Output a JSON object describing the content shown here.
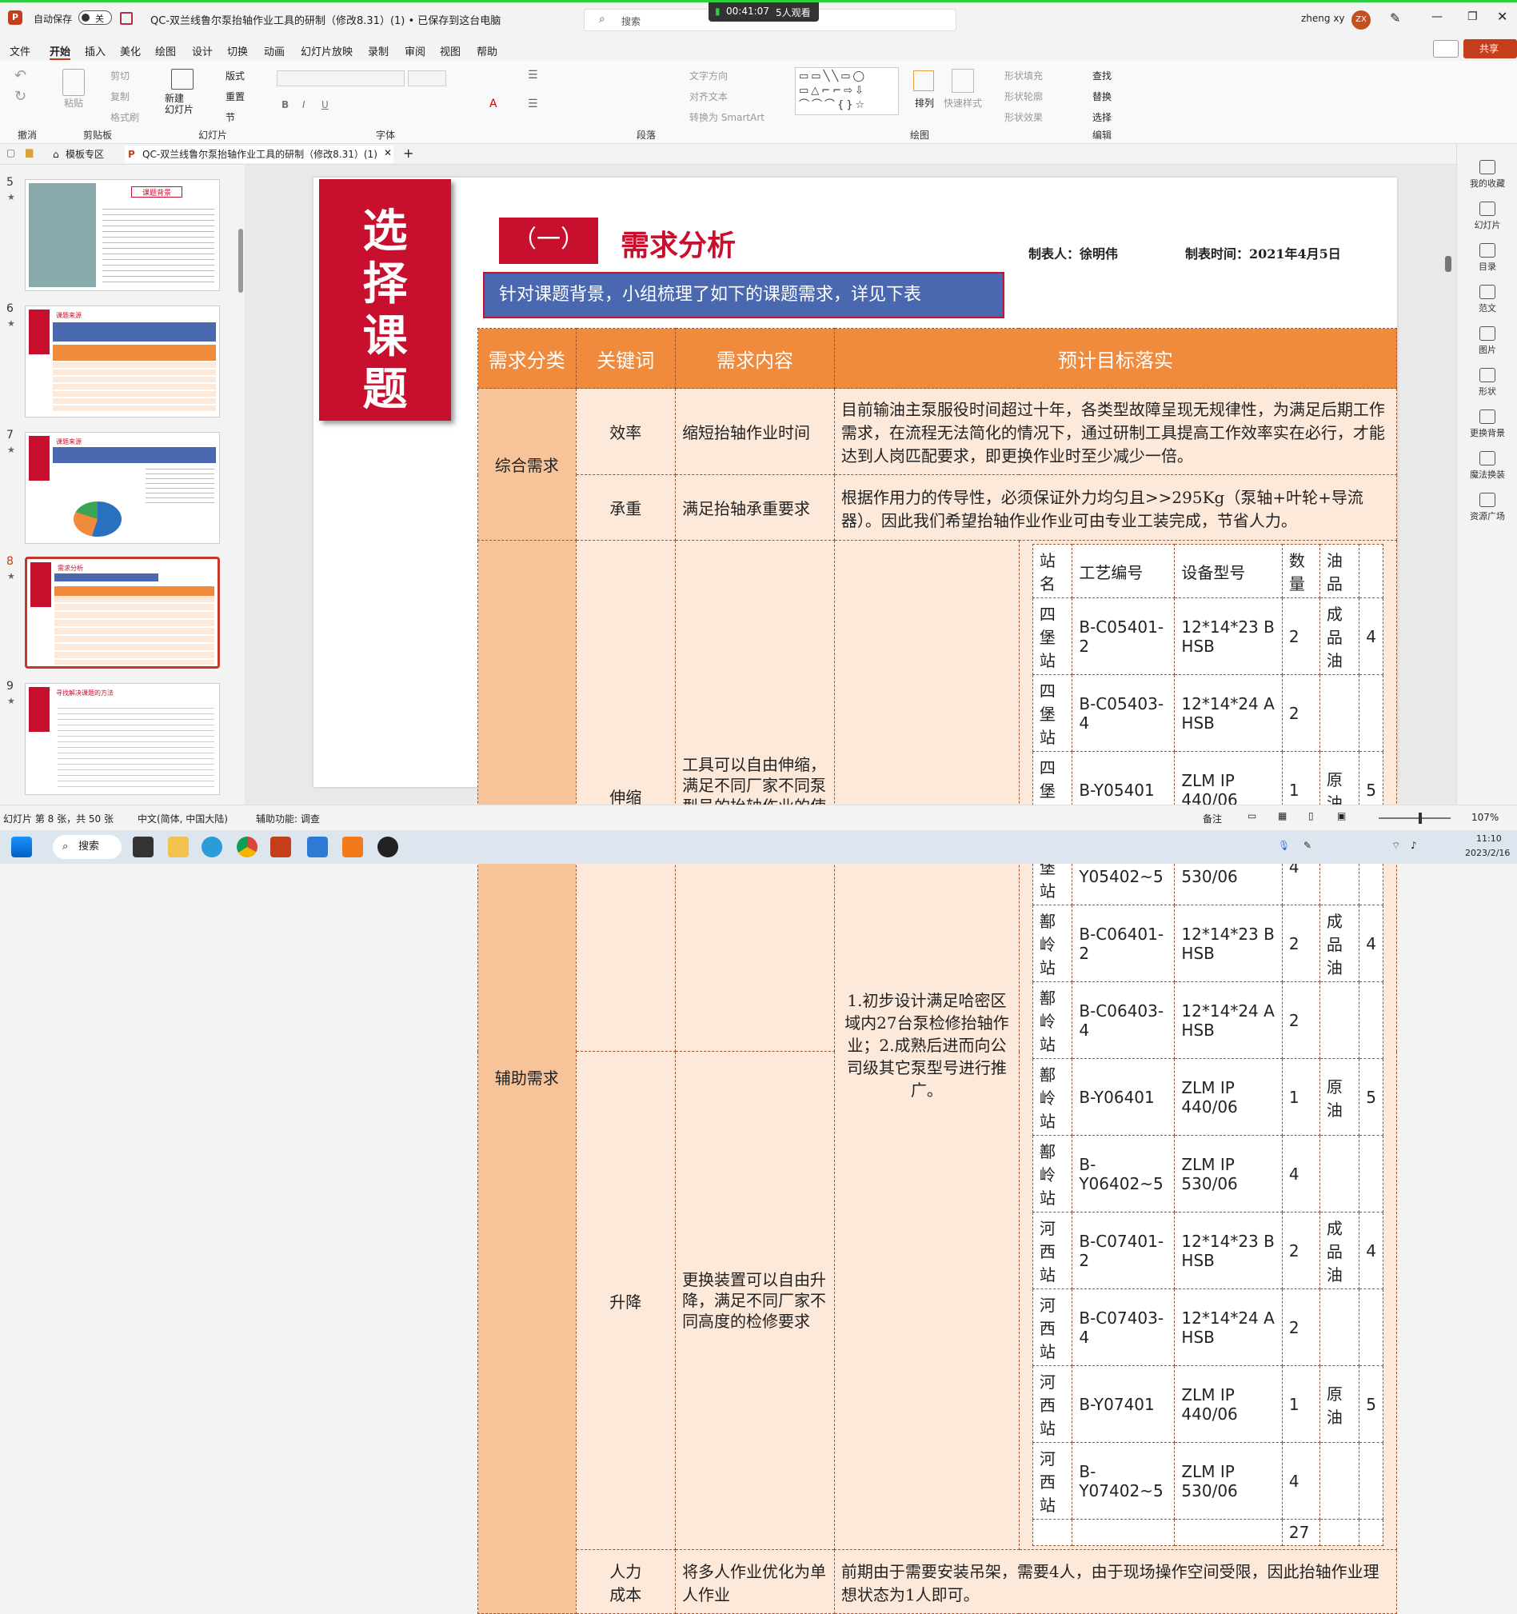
{
  "titlebar": {
    "autosave_label": "自动保存",
    "autosave_state": "关",
    "doc_title": "QC-双兰线鲁尔泵抬轴作业工具的研制（修改8.31）(1) • 已保存到这台电脑",
    "search_placeholder": "搜索",
    "live_time": "00:41:07",
    "live_viewers": "5人观看",
    "user_name": "zheng xy",
    "user_initials": "ZX"
  },
  "menu": [
    "文件",
    "开始",
    "插入",
    "美化",
    "绘图",
    "设计",
    "切换",
    "动画",
    "幻灯片放映",
    "录制",
    "审阅",
    "视图",
    "帮助"
  ],
  "share_label": "共享",
  "ribbon": {
    "undo_group": "撤消",
    "clipboard": {
      "paste": "粘贴",
      "cut": "剪切",
      "copy": "复制",
      "format": "格式刷",
      "label": "剪贴板"
    },
    "slides": {
      "new": "新建\n幻灯片",
      "layout": "版式",
      "reset": "重置",
      "section": "节",
      "label": "幻灯片"
    },
    "font_label": "字体",
    "paragraph": {
      "text_dir": "文字方向",
      "align_text": "对齐文本",
      "smartart": "转换为 SmartArt",
      "label": "段落"
    },
    "drawing": {
      "arrange": "排列",
      "quick_styles": "快速样式",
      "fill": "形状填充",
      "outline": "形状轮廓",
      "effects": "形状效果",
      "label": "绘图"
    },
    "editing": {
      "find": "查找",
      "replace": "替换",
      "select": "选择",
      "label": "编辑"
    }
  },
  "tabs": {
    "template": "模板专区",
    "file_tab": "QC-双兰线鲁尔泵抬轴作业工具的研制（修改8.31）(1)"
  },
  "thumbnails": [
    {
      "num": "5",
      "title": "课题背景"
    },
    {
      "num": "6",
      "title": "课题来源"
    },
    {
      "num": "7",
      "title": "课题来源"
    },
    {
      "num": "8",
      "title": "需求分析"
    },
    {
      "num": "9",
      "title": "寻找解决课题的方法"
    }
  ],
  "slide": {
    "vertical_title": [
      "选",
      "择",
      "课",
      "题"
    ],
    "section_no": "（一）",
    "section_title": "需求分析",
    "maker": "制表人：徐明伟",
    "date": "制表时间：2021年4月5日",
    "banner": "针对课题背景，小组梳理了如下的课题需求，详见下表",
    "headers": [
      "需求分类",
      "关键词",
      "需求内容",
      "预计目标落实"
    ],
    "cat1": "综合需求",
    "cat2": "辅助需求",
    "rows": [
      {
        "kw": "效率",
        "content": "缩短抬轴作业时间",
        "target": "目前输油主泵服役时间超过十年，各类型故障呈现无规律性，为满足后期工作需求，在流程无法简化的情况下，通过研制工具提高工作效率实在必行，才能达到人岗匹配要求，即更换作业时至少减少一倍。"
      },
      {
        "kw": "承重",
        "content": "满足抬轴承重要求",
        "target": "根据作用力的传导性，必须保证外力均匀且>>295Kg（泵轴+叶轮+导流器）。因此我们希望抬轴作业作业可由专业工装完成，节省人力。"
      },
      {
        "kw": "伸缩",
        "content": "工具可以自由伸缩，满足不同厂家不同泵型号的抬轴作业的使用"
      },
      {
        "kw": "升降",
        "content": "更换装置可以自由升降，满足不同厂家不同高度的检修要求"
      },
      {
        "kw": "人力\n成本",
        "content": "将多人作业优化为单人作业",
        "target": "前期由于需要安装吊架，需要4人，由于现场操作空间受限，因此抬轴作业理想状态为1人即可。"
      }
    ],
    "shared_target": "1.初步设计满足哈密区域内27台泵检修抬轴作业；2.成熟后进而向公司级其它泵型号进行推广。",
    "mini_headers": [
      "站名",
      "工艺编号",
      "设备型号",
      "数量",
      "油品",
      ""
    ],
    "mini_rows": [
      [
        "四堡站",
        "B-C05401-2",
        "12*14*23 B HSB",
        "2",
        "成品油",
        "4"
      ],
      [
        "四堡站",
        "B-C05403-4",
        "12*14*24 A HSB",
        "2",
        "",
        ""
      ],
      [
        "四堡站",
        "B-Y05401",
        "ZLM IP 440/06",
        "1",
        "原油",
        "5"
      ],
      [
        "四堡站",
        "B-Y05402~5",
        "ZLM IP 530/06",
        "4",
        "",
        ""
      ],
      [
        "鄯岭站",
        "B-C06401-2",
        "12*14*23 B HSB",
        "2",
        "成品油",
        "4"
      ],
      [
        "鄯岭站",
        "B-C06403-4",
        "12*14*24 A HSB",
        "2",
        "",
        ""
      ],
      [
        "鄯岭站",
        "B-Y06401",
        "ZLM IP 440/06",
        "1",
        "原油",
        "5"
      ],
      [
        "鄯岭站",
        "B-Y06402~5",
        "ZLM IP 530/06",
        "4",
        "",
        ""
      ],
      [
        "河西站",
        "B-C07401-2",
        "12*14*23 B HSB",
        "2",
        "成品油",
        "4"
      ],
      [
        "河西站",
        "B-C07403-4",
        "12*14*24 A HSB",
        "2",
        "",
        ""
      ],
      [
        "河西站",
        "B-Y07401",
        "ZLM IP 440/06",
        "1",
        "原油",
        "5"
      ],
      [
        "河西站",
        "B-Y07402~5",
        "ZLM IP 530/06",
        "4",
        "",
        ""
      ],
      [
        "",
        "",
        "",
        "27",
        "",
        ""
      ]
    ]
  },
  "right_panel": [
    "我的收藏",
    "幻灯片",
    "目录",
    "范文",
    "图片",
    "形状",
    "更换背景",
    "魔法换装",
    "资源广场"
  ],
  "status": {
    "slide_info": "幻灯片 第 8 张，共 50 张",
    "lang": "中文(简体, 中国大陆)",
    "accessibility": "辅助功能: 调查",
    "notes": "备注",
    "zoom": "107%"
  },
  "taskbar": {
    "search": "搜索",
    "time": "11:10",
    "date": "2023/2/16"
  }
}
